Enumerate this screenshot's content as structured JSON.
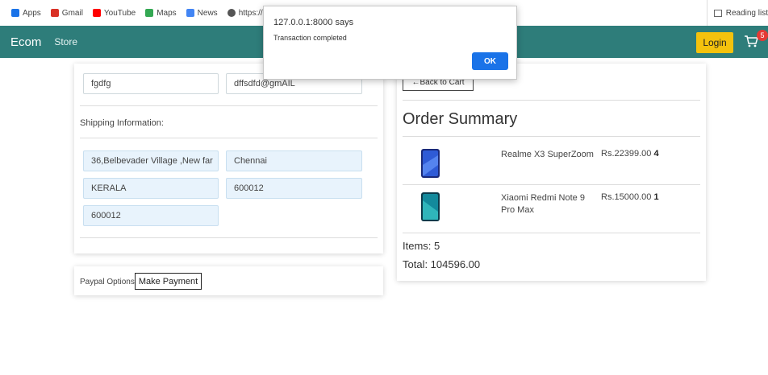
{
  "bookmarks": [
    {
      "label": "Apps",
      "icon": "apps-grid-icon",
      "color": "#1a73e8"
    },
    {
      "label": "Gmail",
      "icon": "gmail-icon",
      "color": "#d93025"
    },
    {
      "label": "YouTube",
      "icon": "youtube-icon",
      "color": "#ff0000"
    },
    {
      "label": "Maps",
      "icon": "maps-icon",
      "color": "#34a853"
    },
    {
      "label": "News",
      "icon": "news-icon",
      "color": "#4285f4"
    },
    {
      "label": "https://me",
      "icon": "globe-icon",
      "color": "#555555"
    }
  ],
  "reading_list": "Reading list",
  "navbar": {
    "brand": "Ecom",
    "store_link": "Store",
    "login_label": "Login",
    "cart_count": "5",
    "bg_color": "#2e7d7a",
    "login_color": "#f4c20d"
  },
  "form": {
    "name": "fgdfg",
    "email": "dffsdfd@gmAIL",
    "shipping_label": "Shipping Information:",
    "address": "36,Belbevader Village ,New far",
    "city": "Chennai",
    "state": "KERALA",
    "zip": "600012",
    "country": "600012"
  },
  "payment": {
    "options_label": "Paypal Options",
    "make_payment_label": "Make Payment"
  },
  "summary": {
    "back_label": "←Back to Cart",
    "title": "Order Summary",
    "items": [
      {
        "name": "Realme X3 SuperZoom",
        "price": "Rs.22399.00",
        "qty": "4",
        "icon": "phone-thumbnail-icon"
      },
      {
        "name": "Xiaomi Redmi Note 9 Pro Max",
        "price": "Rs.15000.00",
        "qty": "1",
        "icon": "phone-thumbnail-icon"
      }
    ],
    "items_text": "Items: 5",
    "total_text": "Total: 104596.00"
  },
  "dialog": {
    "title": "127.0.0.1:8000 says",
    "message": "Transaction completed",
    "ok_label": "OK",
    "ok_color": "#1a73e8"
  }
}
